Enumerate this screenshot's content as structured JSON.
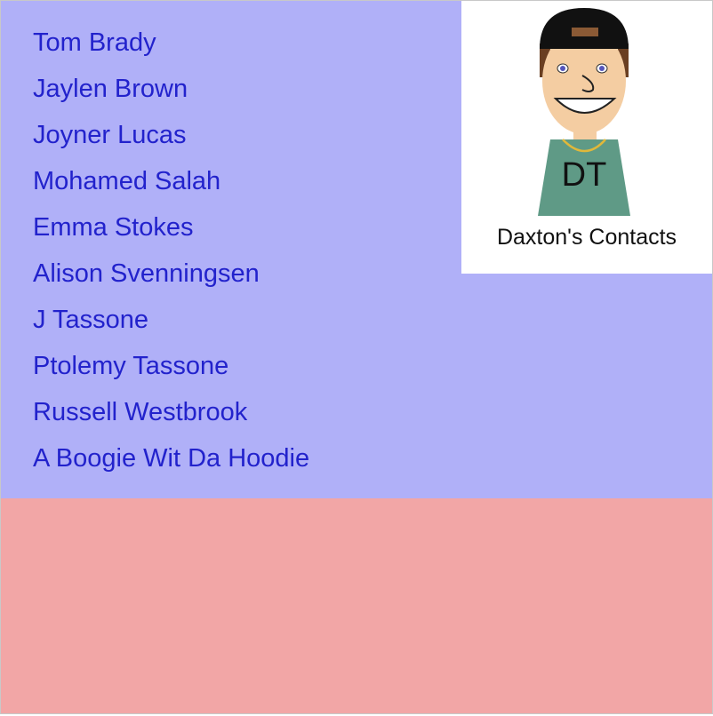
{
  "contacts": [
    {
      "name": "Tom Brady"
    },
    {
      "name": "Jaylen Brown"
    },
    {
      "name": "Joyner Lucas"
    },
    {
      "name": "Mohamed Salah"
    },
    {
      "name": "Emma Stokes"
    },
    {
      "name": "Alison Svenningsen"
    },
    {
      "name": "J Tassone"
    },
    {
      "name": "Ptolemy Tassone"
    },
    {
      "name": "Russell Westbrook"
    },
    {
      "name": "A Boogie Wit Da Hoodie"
    }
  ],
  "profile": {
    "initials": "DT",
    "title": "Daxton's Contacts"
  },
  "colors": {
    "list_background": "#b0b0f8",
    "bottom_background": "#f2a6a6",
    "link": "#2222cc",
    "shirt": "#5f9a86",
    "cap": "#111111"
  }
}
